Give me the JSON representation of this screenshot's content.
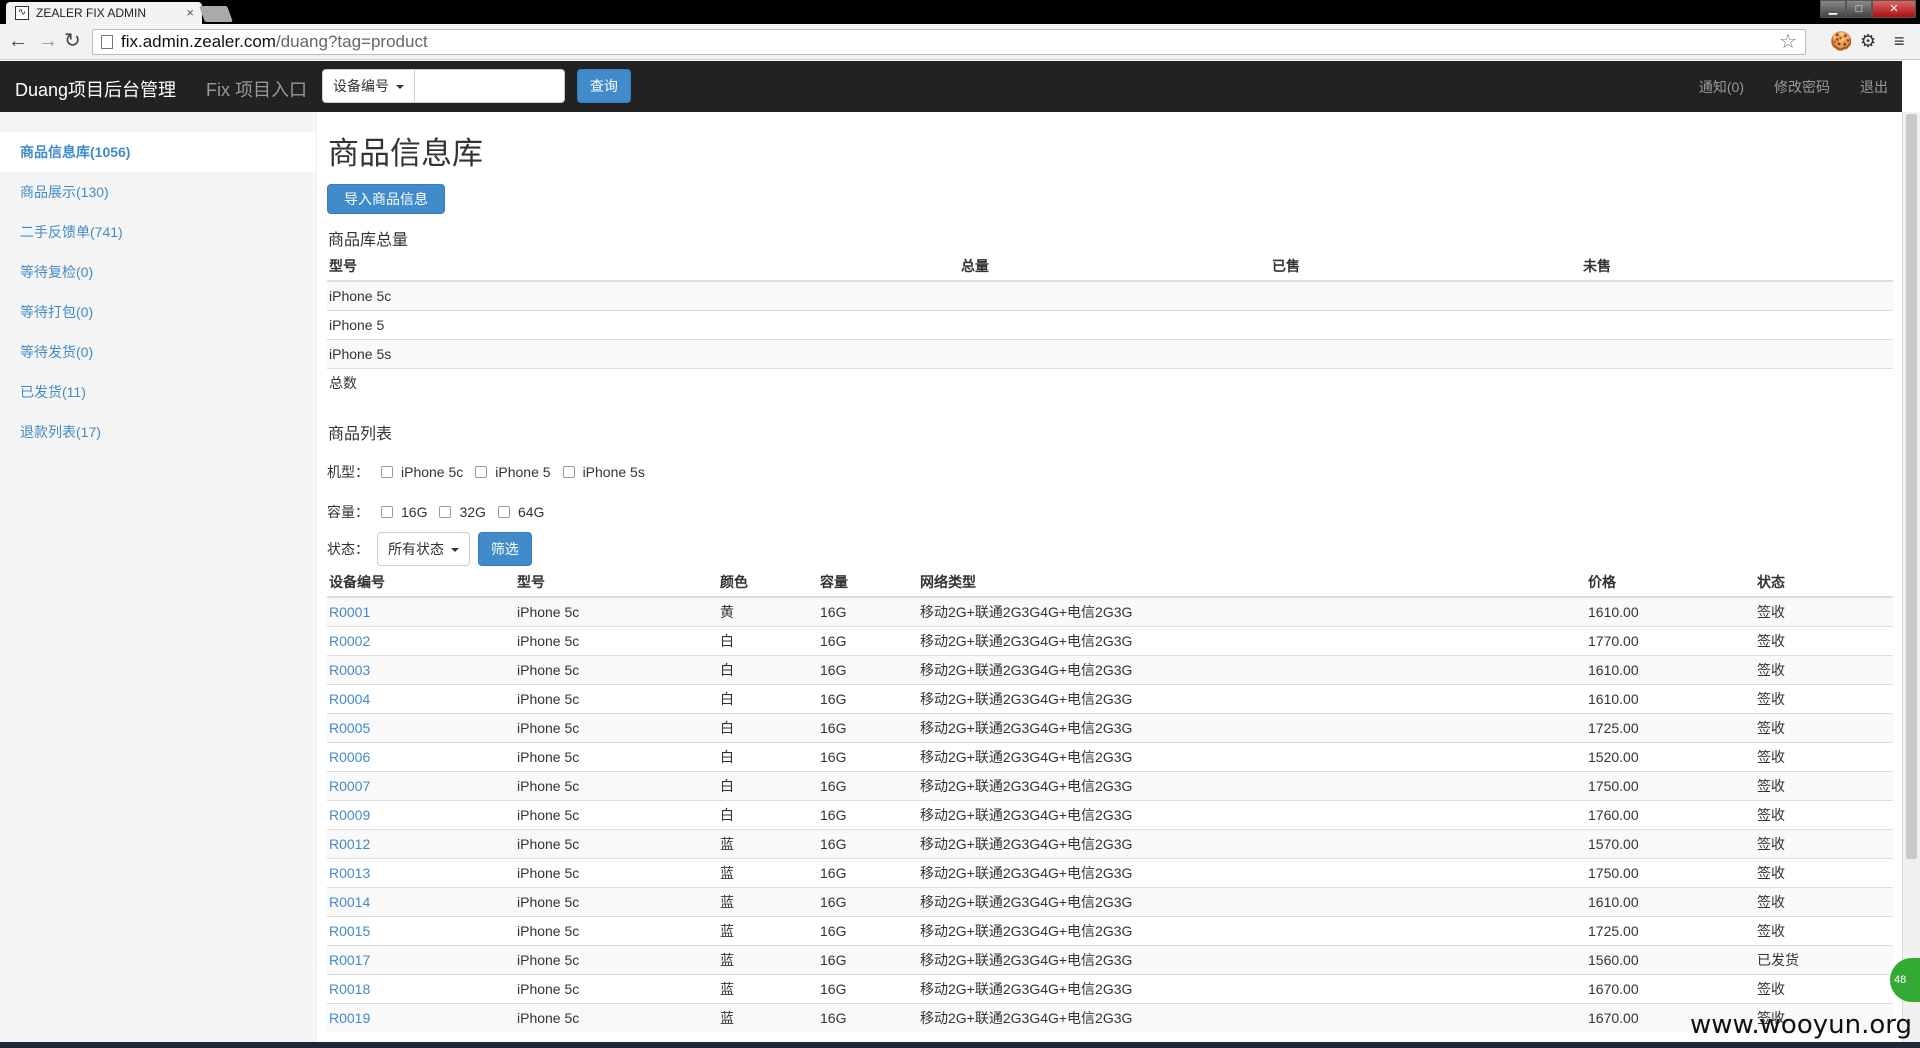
{
  "browser": {
    "tab_title": "ZEALER FIX ADMIN",
    "tab_close": "×",
    "url_host": "fix.admin.zealer.com",
    "url_path": "/duang?tag=product",
    "back": "←",
    "forward": "→",
    "reload": "↻",
    "star": "☆",
    "cookie": "🍪",
    "settings": "⚙",
    "menu": "≡",
    "win_min": "▁",
    "win_max": "□",
    "win_close": "✕"
  },
  "navbar": {
    "brand": "Duang项目后台管理",
    "fix_link": "Fix 项目入口",
    "search_dropdown": "设备编号",
    "search_button": "查询",
    "notifications": "通知(0)",
    "change_password": "修改密码",
    "logout": "退出"
  },
  "sidebar": {
    "items": [
      {
        "label": "商品信息库(1056)"
      },
      {
        "label": "商品展示(130)"
      },
      {
        "label": "二手反馈单(741)"
      },
      {
        "label": "等待复检(0)"
      },
      {
        "label": "等待打包(0)"
      },
      {
        "label": "等待发货(0)"
      },
      {
        "label": "已发货(11)"
      },
      {
        "label": "退款列表(17)"
      }
    ]
  },
  "main": {
    "page_title": "商品信息库",
    "import_button": "导入商品信息",
    "summary_title": "商品库总量",
    "summary_headers": [
      "型号",
      "总量",
      "已售",
      "未售"
    ],
    "summary_rows": [
      [
        "iPhone 5c",
        "",
        "",
        ""
      ],
      [
        "iPhone 5",
        "",
        "",
        ""
      ],
      [
        "iPhone 5s",
        "",
        "",
        ""
      ],
      [
        "总数",
        "",
        "",
        ""
      ]
    ],
    "list_title": "商品列表",
    "filters": {
      "model_label": "机型：",
      "models": [
        "iPhone 5c",
        "iPhone 5",
        "iPhone 5s"
      ],
      "capacity_label": "容量：",
      "capacities": [
        "16G",
        "32G",
        "64G"
      ],
      "status_label": "状态：",
      "status_value": "所有状态",
      "filter_button": "筛选"
    },
    "list_headers": [
      "设备编号",
      "型号",
      "颜色",
      "容量",
      "网络类型",
      "价格",
      "状态"
    ],
    "list_rows": [
      [
        "R0001",
        "iPhone 5c",
        "黄",
        "16G",
        "移动2G+联通2G3G4G+电信2G3G",
        "1610.00",
        "签收"
      ],
      [
        "R0002",
        "iPhone 5c",
        "白",
        "16G",
        "移动2G+联通2G3G4G+电信2G3G",
        "1770.00",
        "签收"
      ],
      [
        "R0003",
        "iPhone 5c",
        "白",
        "16G",
        "移动2G+联通2G3G4G+电信2G3G",
        "1610.00",
        "签收"
      ],
      [
        "R0004",
        "iPhone 5c",
        "白",
        "16G",
        "移动2G+联通2G3G4G+电信2G3G",
        "1610.00",
        "签收"
      ],
      [
        "R0005",
        "iPhone 5c",
        "白",
        "16G",
        "移动2G+联通2G3G4G+电信2G3G",
        "1725.00",
        "签收"
      ],
      [
        "R0006",
        "iPhone 5c",
        "白",
        "16G",
        "移动2G+联通2G3G4G+电信2G3G",
        "1520.00",
        "签收"
      ],
      [
        "R0007",
        "iPhone 5c",
        "白",
        "16G",
        "移动2G+联通2G3G4G+电信2G3G",
        "1750.00",
        "签收"
      ],
      [
        "R0009",
        "iPhone 5c",
        "白",
        "16G",
        "移动2G+联通2G3G4G+电信2G3G",
        "1760.00",
        "签收"
      ],
      [
        "R0012",
        "iPhone 5c",
        "蓝",
        "16G",
        "移动2G+联通2G3G4G+电信2G3G",
        "1570.00",
        "签收"
      ],
      [
        "R0013",
        "iPhone 5c",
        "蓝",
        "16G",
        "移动2G+联通2G3G4G+电信2G3G",
        "1750.00",
        "签收"
      ],
      [
        "R0014",
        "iPhone 5c",
        "蓝",
        "16G",
        "移动2G+联通2G3G4G+电信2G3G",
        "1610.00",
        "签收"
      ],
      [
        "R0015",
        "iPhone 5c",
        "蓝",
        "16G",
        "移动2G+联通2G3G4G+电信2G3G",
        "1725.00",
        "签收"
      ],
      [
        "R0017",
        "iPhone 5c",
        "蓝",
        "16G",
        "移动2G+联通2G3G4G+电信2G3G",
        "1560.00",
        "已发货"
      ],
      [
        "R0018",
        "iPhone 5c",
        "蓝",
        "16G",
        "移动2G+联通2G3G4G+电信2G3G",
        "1670.00",
        "签收"
      ],
      [
        "R0019",
        "iPhone 5c",
        "蓝",
        "16G",
        "移动2G+联通2G3G4G+电信2G3G",
        "1670.00",
        "签收"
      ]
    ]
  },
  "overlay": {
    "watermark": "www.wooyun.org",
    "badge": "48"
  },
  "colors": {
    "navbar": "#222222",
    "primary": "#428bca",
    "sidebar_bg": "#f5f5f5"
  }
}
